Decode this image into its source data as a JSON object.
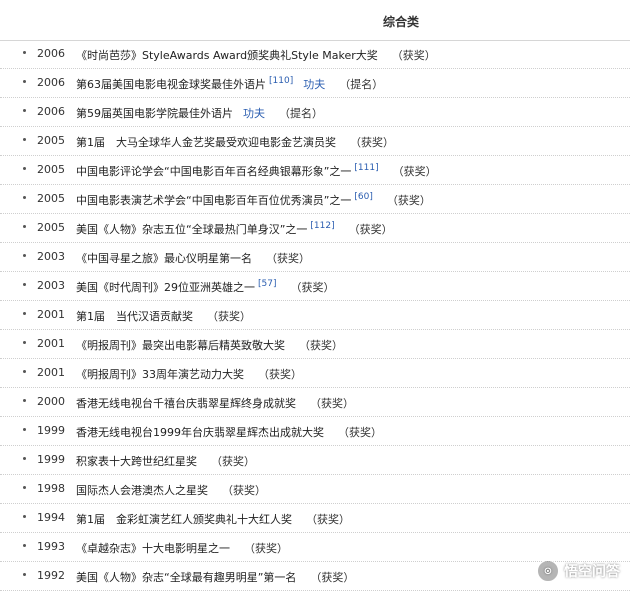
{
  "header": {
    "title": "综合类"
  },
  "awards": [
    {
      "year": "2006",
      "text": "《时尚芭莎》StyleAwards Award颁奖典礼Style Maker大奖",
      "ref": "",
      "link": "",
      "result": "（获奖）"
    },
    {
      "year": "2006",
      "text": "第63届美国电影电视金球奖最佳外语片",
      "ref": "[110]",
      "link": "功夫",
      "result": "（提名）"
    },
    {
      "year": "2006",
      "text": "第59届英国电影学院最佳外语片",
      "ref": "",
      "link": "功夫",
      "result": "（提名）"
    },
    {
      "year": "2005",
      "text": "第1届　大马全球华人金艺奖最受欢迎电影金艺演员奖",
      "ref": "",
      "link": "",
      "result": "（获奖）"
    },
    {
      "year": "2005",
      "text": "中国电影评论学会“中国电影百年百名经典银幕形象”之一",
      "ref": "[111]",
      "link": "",
      "result": "（获奖）"
    },
    {
      "year": "2005",
      "text": "中国电影表演艺术学会“中国电影百年百位优秀演员”之一",
      "ref": "[60]",
      "link": "",
      "result": "（获奖）"
    },
    {
      "year": "2005",
      "text": "美国《人物》杂志五位“全球最热门单身汉”之一",
      "ref": "[112]",
      "link": "",
      "result": "（获奖）"
    },
    {
      "year": "2003",
      "text": "《中国寻星之旅》最心仪明星第一名",
      "ref": "",
      "link": "",
      "result": "（获奖）"
    },
    {
      "year": "2003",
      "text": "美国《时代周刊》29位亚洲英雄之一",
      "ref": "[57]",
      "link": "",
      "result": "（获奖）"
    },
    {
      "year": "2001",
      "text": "第1届　当代汉语贡献奖",
      "ref": "",
      "link": "",
      "result": "（获奖）"
    },
    {
      "year": "2001",
      "text": "《明报周刊》最突出电影幕后精英致敬大奖",
      "ref": "",
      "link": "",
      "result": "（获奖）"
    },
    {
      "year": "2001",
      "text": "《明报周刊》33周年演艺动力大奖",
      "ref": "",
      "link": "",
      "result": "（获奖）"
    },
    {
      "year": "2000",
      "text": "香港无线电视台千禧台庆翡翠星辉终身成就奖",
      "ref": "",
      "link": "",
      "result": "（获奖）"
    },
    {
      "year": "1999",
      "text": "香港无线电视台1999年台庆翡翠星辉杰出成就大奖",
      "ref": "",
      "link": "",
      "result": "（获奖）"
    },
    {
      "year": "1999",
      "text": "积家表十大跨世纪红星奖",
      "ref": "",
      "link": "",
      "result": "（获奖）"
    },
    {
      "year": "1998",
      "text": "国际杰人会港澳杰人之星奖",
      "ref": "",
      "link": "",
      "result": "（获奖）"
    },
    {
      "year": "1994",
      "text": "第1届　金彩虹演艺红人颁奖典礼十大红人奖",
      "ref": "",
      "link": "",
      "result": "（获奖）"
    },
    {
      "year": "1993",
      "text": "《卓越杂志》十大电影明星之一",
      "ref": "",
      "link": "",
      "result": "（获奖）"
    },
    {
      "year": "1992",
      "text": "美国《人物》杂志“全球最有趣男明星”第一名",
      "ref": "",
      "link": "",
      "result": "（获奖）"
    }
  ],
  "watermark": {
    "text": "悟空问答"
  }
}
